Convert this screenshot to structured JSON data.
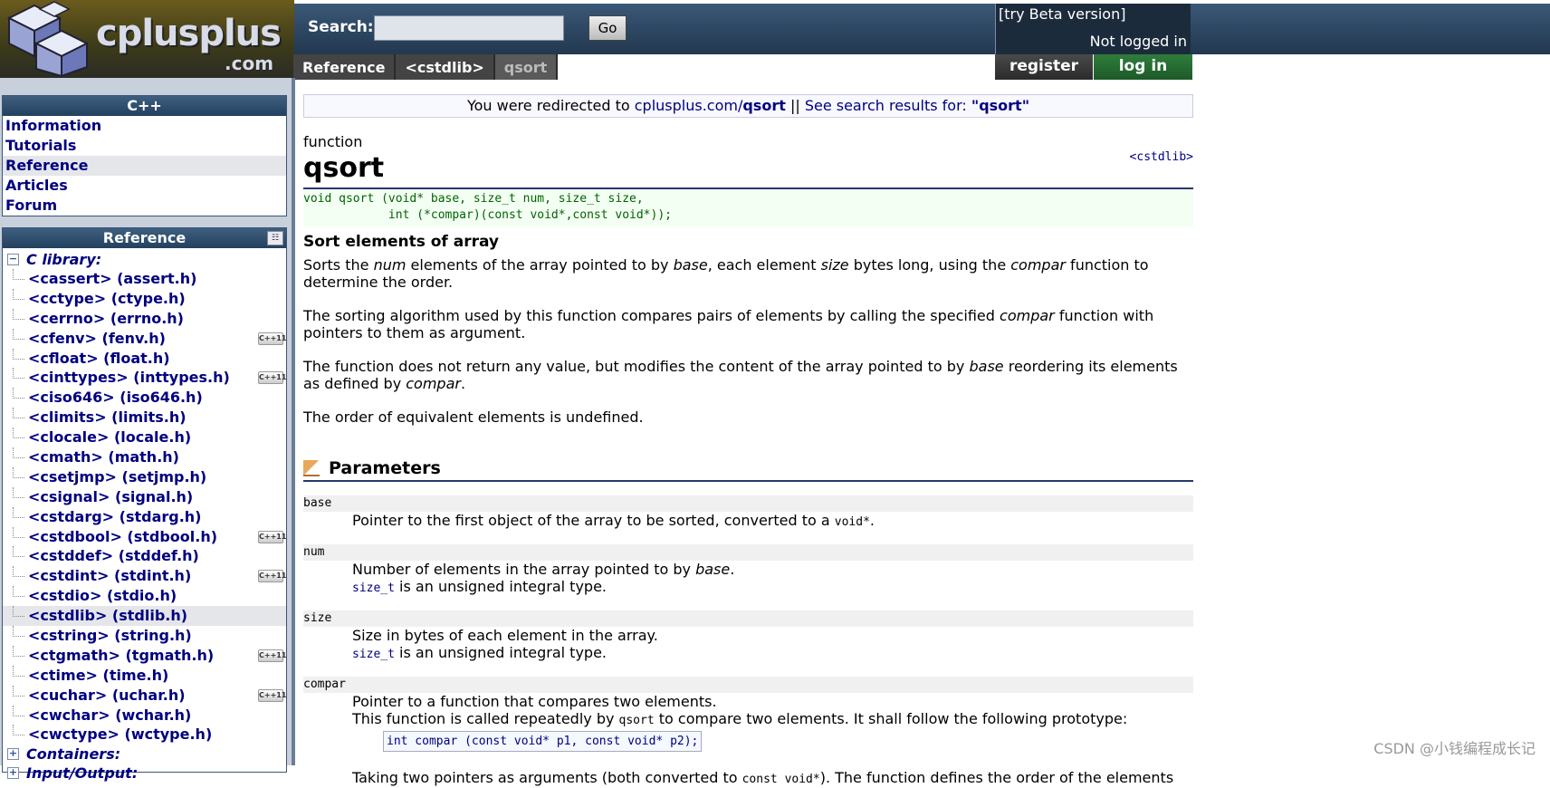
{
  "header": {
    "logo_text": "cplusplus",
    "logo_domain": ".com",
    "search_label": "Search:",
    "search_value": "",
    "go_label": "Go",
    "breadcrumbs": [
      "Reference",
      "<cstdlib>",
      "qsort"
    ],
    "beta_link": "[try Beta version]",
    "login_status": "Not logged in",
    "register_label": "register",
    "login_label": "log in"
  },
  "sidebar": {
    "cpp_title": "C++",
    "cpp_items": [
      "Information",
      "Tutorials",
      "Reference",
      "Articles",
      "Forum"
    ],
    "ref_title": "Reference",
    "category_c_library": "C library:",
    "library_items": [
      {
        "label": "<cassert> (assert.h)",
        "cxx11": false
      },
      {
        "label": "<cctype> (ctype.h)",
        "cxx11": false
      },
      {
        "label": "<cerrno> (errno.h)",
        "cxx11": false
      },
      {
        "label": "<cfenv> (fenv.h)",
        "cxx11": true
      },
      {
        "label": "<cfloat> (float.h)",
        "cxx11": false
      },
      {
        "label": "<cinttypes> (inttypes.h)",
        "cxx11": true
      },
      {
        "label": "<ciso646> (iso646.h)",
        "cxx11": false
      },
      {
        "label": "<climits> (limits.h)",
        "cxx11": false
      },
      {
        "label": "<clocale> (locale.h)",
        "cxx11": false
      },
      {
        "label": "<cmath> (math.h)",
        "cxx11": false
      },
      {
        "label": "<csetjmp> (setjmp.h)",
        "cxx11": false
      },
      {
        "label": "<csignal> (signal.h)",
        "cxx11": false
      },
      {
        "label": "<cstdarg> (stdarg.h)",
        "cxx11": false
      },
      {
        "label": "<cstdbool> (stdbool.h)",
        "cxx11": true
      },
      {
        "label": "<cstddef> (stddef.h)",
        "cxx11": false
      },
      {
        "label": "<cstdint> (stdint.h)",
        "cxx11": true
      },
      {
        "label": "<cstdio> (stdio.h)",
        "cxx11": false
      },
      {
        "label": "<cstdlib> (stdlib.h)",
        "cxx11": false
      },
      {
        "label": "<cstring> (string.h)",
        "cxx11": false
      },
      {
        "label": "<ctgmath> (tgmath.h)",
        "cxx11": true
      },
      {
        "label": "<ctime> (time.h)",
        "cxx11": false
      },
      {
        "label": "<cuchar> (uchar.h)",
        "cxx11": true
      },
      {
        "label": "<cwchar> (wchar.h)",
        "cxx11": false
      },
      {
        "label": "<cwctype> (wctype.h)",
        "cxx11": false
      }
    ],
    "active_item": "<cstdlib> (stdlib.h)",
    "category_containers": "Containers:",
    "category_io": "Input/Output:",
    "badge_text": "C++11"
  },
  "main": {
    "redirect": {
      "prefix": "You were redirected to ",
      "link_text": "cplusplus.com/",
      "link_bold": "qsort",
      "separator": " || ",
      "search_text": "See search results for: ",
      "search_term": "\"qsort\""
    },
    "kind": "function",
    "title": "qsort",
    "header_name": "<cstdlib>",
    "prototype_line1": "void qsort (void* base, size_t num, size_t size,",
    "prototype_line2": "            int (*compar)(const void*,const void*));",
    "short_desc": "Sort elements of array",
    "paragraphs": {
      "p1": [
        "Sorts the ",
        "num",
        " elements of the array pointed to by ",
        "base",
        ", each element ",
        "size",
        " bytes long, using the ",
        "compar",
        " function to determine the order."
      ],
      "p2": [
        "The sorting algorithm used by this function compares pairs of elements by calling the specified ",
        "compar",
        " function with pointers to them as argument."
      ],
      "p3": [
        "The function does not return any value, but modifies the content of the array pointed to by ",
        "base",
        " reordering its elements as defined by ",
        "compar",
        "."
      ],
      "p4": "The order of equivalent elements is undefined."
    },
    "params_heading": "Parameters",
    "params": {
      "base": {
        "name": "base",
        "text": "Pointer to the first object of the array to be sorted, converted to a ",
        "code": "void*",
        "tail": "."
      },
      "num": {
        "name": "num",
        "line1_a": "Number of elements in the array pointed to by ",
        "line1_em": "base",
        "line1_b": ".",
        "code": "size_t",
        "line2": " is an unsigned integral type."
      },
      "size": {
        "name": "size",
        "line1": "Size in bytes of each element in the array.",
        "code": "size_t",
        "line2": " is an unsigned integral type."
      },
      "compar": {
        "name": "compar",
        "line1": "Pointer to a function that compares two elements.",
        "line2_a": "This function is called repeatedly by ",
        "line2_code": "qsort",
        "line2_b": " to compare two elements. It shall follow the following prototype:",
        "proto": "int compar (const void* p1, const void* p2);",
        "line3_a": "Taking two pointers as arguments (both converted to ",
        "line3_code": "const void*",
        "line3_b": "). The function defines the order of the elements"
      }
    }
  },
  "watermark": "CSDN @小钱编程成长记"
}
